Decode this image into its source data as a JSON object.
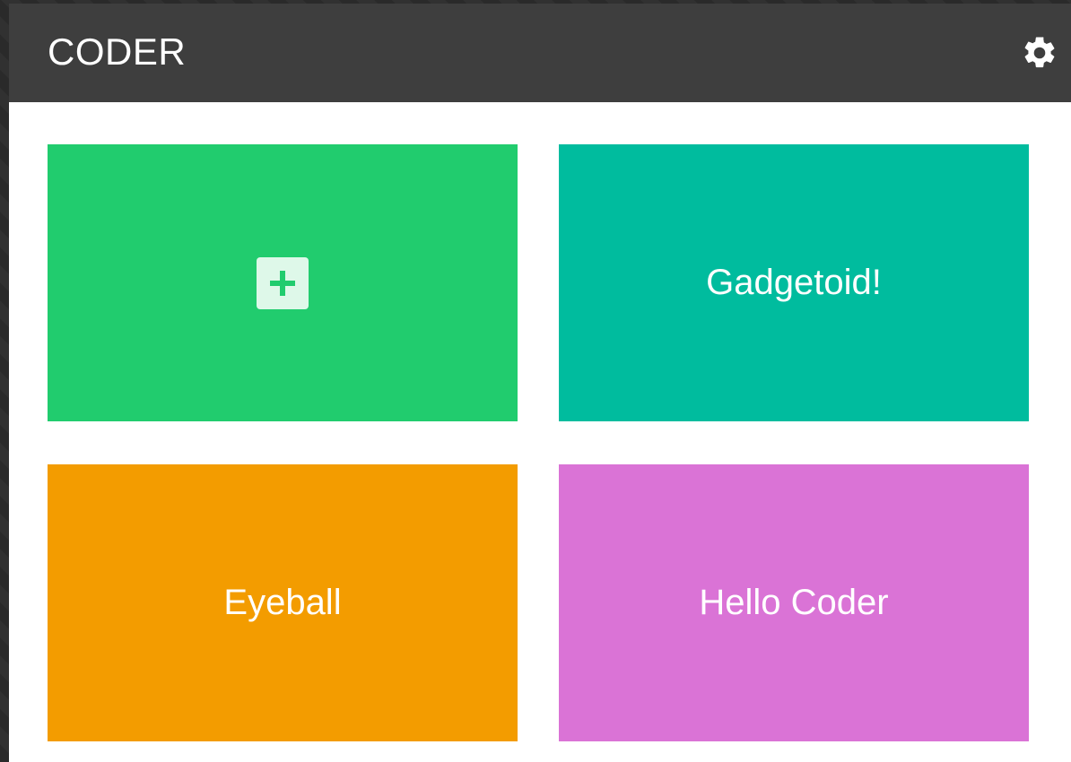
{
  "header": {
    "title": "CODER",
    "settings_icon": "gear-icon"
  },
  "tiles": [
    {
      "label": "",
      "icon": "plus-icon",
      "color": "#21cc6e"
    },
    {
      "label": "Gadgetoid!",
      "color": "#00bc9e"
    },
    {
      "label": "Eyeball",
      "color": "#f39c00"
    },
    {
      "label": "Hello Coder",
      "color": "#da73d6"
    }
  ],
  "colors": {
    "header_bg": "#3e3e3e",
    "content_bg": "#ffffff",
    "plus_icon": "#21cc6e"
  }
}
